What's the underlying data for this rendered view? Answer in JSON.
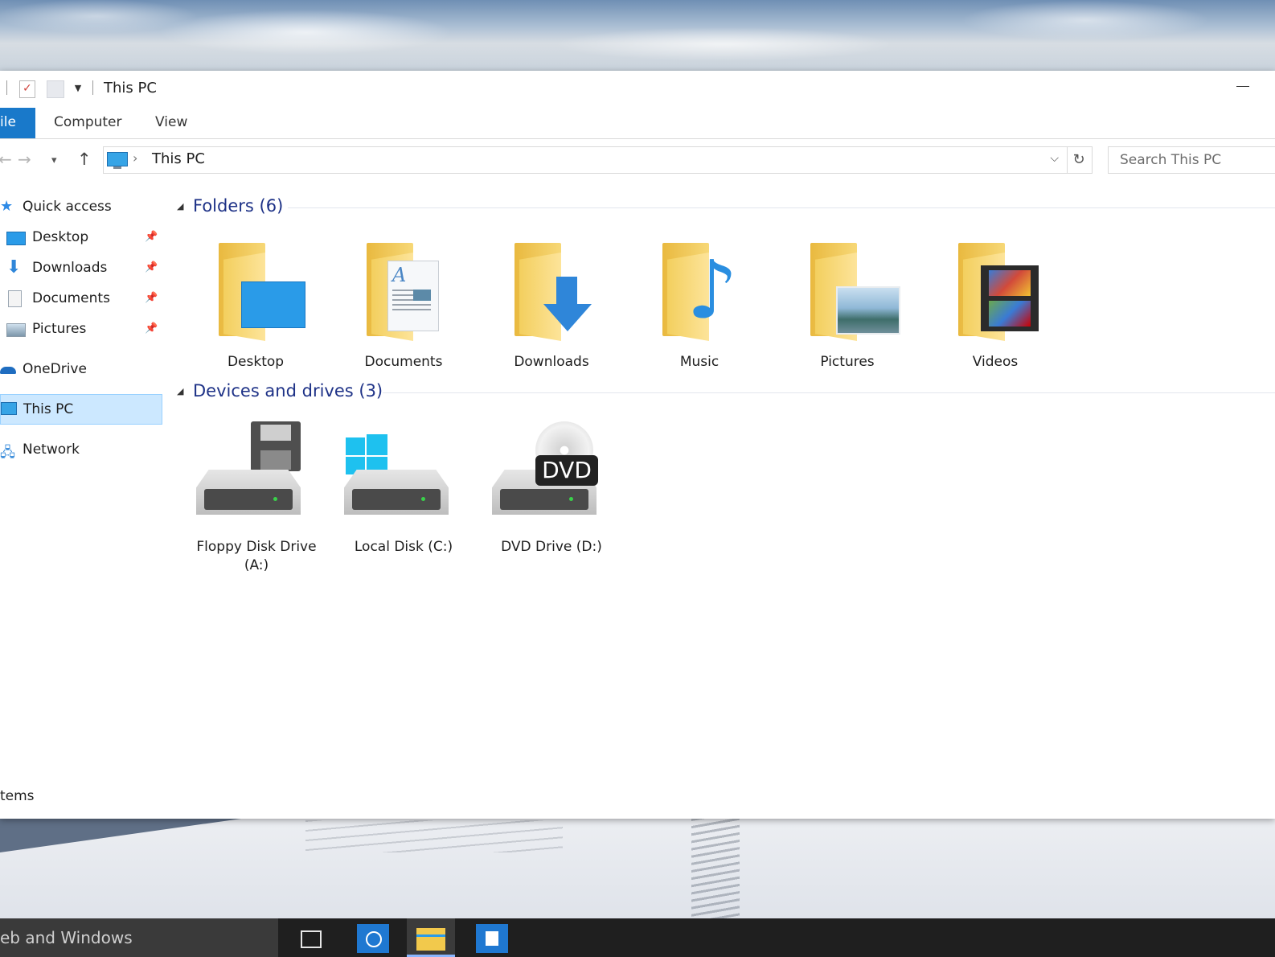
{
  "window": {
    "title": "This PC",
    "ribbon_tabs": [
      "ile",
      "Computer",
      "View"
    ]
  },
  "address": {
    "path": "This PC",
    "search_placeholder": "Search This PC"
  },
  "navigation": {
    "items": [
      {
        "label": "Quick access",
        "icon": "star-icon"
      },
      {
        "label": "Desktop",
        "icon": "desktop-icon",
        "pinned": true
      },
      {
        "label": "Downloads",
        "icon": "download-arrow-icon",
        "pinned": true
      },
      {
        "label": "Documents",
        "icon": "documents-icon",
        "pinned": true
      },
      {
        "label": "Pictures",
        "icon": "pictures-icon",
        "pinned": true
      },
      {
        "label": "OneDrive",
        "icon": "cloud-icon"
      },
      {
        "label": "This PC",
        "icon": "computer-icon",
        "selected": true
      },
      {
        "label": "Network",
        "icon": "network-icon"
      }
    ]
  },
  "groups": {
    "folders": {
      "title": "Folders (6)",
      "items": [
        {
          "label": "Desktop",
          "icon": "desktop-folder-icon"
        },
        {
          "label": "Documents",
          "icon": "documents-folder-icon"
        },
        {
          "label": "Downloads",
          "icon": "downloads-folder-icon"
        },
        {
          "label": "Music",
          "icon": "music-folder-icon"
        },
        {
          "label": "Pictures",
          "icon": "pictures-folder-icon"
        },
        {
          "label": "Videos",
          "icon": "videos-folder-icon"
        }
      ]
    },
    "drives": {
      "title": "Devices and drives (3)",
      "items": [
        {
          "label": "Floppy Disk Drive (A:)",
          "icon": "floppy-drive-icon"
        },
        {
          "label": "Local Disk (C:)",
          "icon": "local-disk-icon"
        },
        {
          "label": "DVD Drive (D:)",
          "icon": "dvd-drive-icon",
          "badge": "DVD"
        }
      ]
    }
  },
  "status": {
    "text": "tems"
  },
  "taskbar": {
    "search_text": "eb and Windows"
  },
  "colors": {
    "accent": "#1979ca",
    "selection": "#cce8ff",
    "group_header": "#1e3287"
  }
}
